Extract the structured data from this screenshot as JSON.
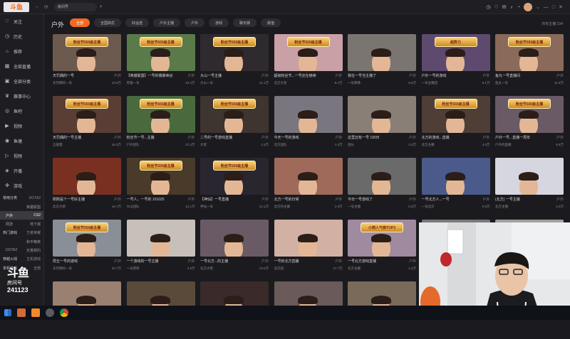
{
  "top": {
    "logo": "斗鱼",
    "search_text": "房间号",
    "nav_back": "←",
    "nav_refresh": "⟳"
  },
  "sidebar": {
    "items": [
      {
        "label": "关注",
        "icon": "heart-icon"
      },
      {
        "label": "历史",
        "icon": "clock-icon"
      },
      {
        "label": "推荐",
        "icon": "home-icon"
      },
      {
        "label": "全部直播",
        "icon": "grid-icon"
      },
      {
        "label": "全部分类",
        "icon": "category-icon"
      },
      {
        "label": "赛事中心",
        "icon": "trophy-icon"
      },
      {
        "label": "鱼吧",
        "icon": "fish-icon"
      },
      {
        "label": "视频",
        "icon": "video-icon"
      },
      {
        "label": "鱼塘",
        "icon": "pond-icon"
      },
      {
        "label": "视频",
        "icon": "play-icon"
      },
      {
        "label": "开播",
        "icon": "broadcast-icon"
      },
      {
        "label": "游戏",
        "icon": "game-icon"
      }
    ],
    "groups": [
      {
        "label": "常用分类",
        "count": "DOTA2"
      },
      {
        "label": "",
        "count": "英雄联盟"
      },
      {
        "label": "户外",
        "count": "CS2"
      },
      {
        "label": "网游",
        "count": "地下城"
      },
      {
        "label": "热门游戏",
        "count": "王者荣耀"
      },
      {
        "label": "",
        "count": "和平精英"
      },
      {
        "label": "DOTA2",
        "count": "无畏契约"
      },
      {
        "label": "穿越火线",
        "count": "主机游戏"
      },
      {
        "label": "单机游戏",
        "count": "全部"
      }
    ],
    "brand_logo": "斗鱼",
    "brand_room_label": "房间号",
    "brand_room_number": "241123"
  },
  "main": {
    "category_title": "户外",
    "tabs": [
      "全部",
      "全国高优",
      "好运连",
      "户外主播",
      "户外",
      "游戏",
      "聊天娱",
      "颜值"
    ],
    "sort_note": "共有主播 234"
  },
  "cards": [
    {
      "title": "天罚偶的一号",
      "cat": "户外",
      "streamer": "天罚偶的一号",
      "views": "10.6万",
      "thumb": "#6d5a4e",
      "banner": "粉丝节555级主播"
    },
    {
      "title": "【英雄联盟】一号的偶像峡谷",
      "cat": "户外",
      "streamer": "英雄一号",
      "views": "23.4万",
      "thumb": "#5a7a4a",
      "banner": "粉丝节555级主播"
    },
    {
      "title": "大山一号主播",
      "cat": "户外",
      "streamer": "大山一号",
      "views": "12.1万",
      "thumb": "#2f2a2e",
      "banner": "粉丝节555级主播"
    },
    {
      "title": "超级粉丝节...一号还在继续",
      "cat": "户外",
      "streamer": "北方大星",
      "views": "8.2万",
      "thumb": "#c8a0a6",
      "banner": "粉丝节555级主播"
    },
    {
      "title": "我在一号当主播了",
      "cat": "户外",
      "streamer": "一号偶像",
      "views": "5.6万",
      "thumb": "#7a7570",
      "banner": ""
    },
    {
      "title": "户外一号的游戏",
      "cat": "户外",
      "streamer": "一号主播团",
      "views": "9.1万",
      "thumb": "#5e4a6e",
      "banner": "超势力"
    },
    {
      "title": "鱼丸一号直播间",
      "cat": "户外",
      "streamer": "鱼丸一号",
      "views": "11.9万",
      "thumb": "#8a6a5a",
      "banner": "粉丝节555级主播"
    },
    {
      "title": "天罚偶的一号主播",
      "cat": "户外",
      "streamer": "正能量",
      "views": "16.3万",
      "thumb": "#5a3e36",
      "banner": "粉丝节555级主播"
    },
    {
      "title": "粉丝节一号...主播",
      "cat": "户外",
      "streamer": "户外团队",
      "views": "27.4万",
      "thumb": "#4a6a3e",
      "banner": "粉丝节555级主播"
    },
    {
      "title": "二号的一号游戏直播",
      "cat": "户外",
      "streamer": "大佬",
      "views": "1.5万",
      "thumb": "#3e3430",
      "banner": "粉丝节555级主播"
    },
    {
      "title": "今天一号的游戏",
      "cat": "户外",
      "streamer": "北方团队",
      "views": "1.4万",
      "thumb": "#7a7680",
      "banner": ""
    },
    {
      "title": "这里还有一号 190日",
      "cat": "户外",
      "streamer": "团长",
      "views": "2.0万",
      "thumb": "#8a7f76",
      "banner": ""
    },
    {
      "title": "北方的游戏...直播",
      "cat": "户外",
      "streamer": "北方主播",
      "views": "4.5万",
      "thumb": "#4e3e36",
      "banner": "粉丝节555级主播"
    },
    {
      "title": "户外一号...直播一周年",
      "cat": "户外",
      "streamer": "户外的直播",
      "views": "5.5万",
      "thumb": "#6a5a66",
      "banner": "粉丝节555级主播"
    },
    {
      "title": "刚刚是个一号好主播",
      "cat": "户外",
      "streamer": "北方大佬",
      "views": "16.7万",
      "thumb": "#7a3020",
      "banner": ""
    },
    {
      "title": "一号人，一号的 101025",
      "cat": "户外",
      "streamer": "大山团队",
      "views": "12.1万",
      "thumb": "#4a3a2a",
      "banner": "粉丝节555级主播"
    },
    {
      "title": "【神仙】一号直播",
      "cat": "户外",
      "streamer": "神仙一号",
      "views": "13.1万",
      "thumb": "#2a2630",
      "banner": "粉丝节555级主播"
    },
    {
      "title": "北方一号的日常",
      "cat": "户外",
      "streamer": "北方的主播",
      "views": "2.9万",
      "thumb": "#a06a5a",
      "banner": ""
    },
    {
      "title": "今日一号游戏了",
      "cat": "户外",
      "streamer": "一号主播",
      "views": "0.6万",
      "thumb": "#6a6a6a",
      "banner": ""
    },
    {
      "title": "一号北方人...一号",
      "cat": "户外",
      "streamer": "一号北方",
      "views": "0.6万",
      "thumb": "#4a5a8a",
      "banner": ""
    },
    {
      "title": "(北方) 一号主播",
      "cat": "户外",
      "streamer": "北方主播",
      "views": "3.3万",
      "thumb": "#d6d6e0",
      "banner": ""
    },
    {
      "title": "周五一号的游戏",
      "cat": "户外",
      "streamer": "天罚偶的一号",
      "views": "20.7万",
      "thumb": "#8a8e96",
      "banner": "粉丝节555级主播"
    },
    {
      "title": "一个游戏的一号主播",
      "cat": "户外",
      "streamer": "一号游戏",
      "views": "3.9万",
      "thumb": "#c6c0b8",
      "banner": ""
    },
    {
      "title": "一号北方...的主播",
      "cat": "户外",
      "streamer": "北方大佬",
      "views": "13.0万",
      "thumb": "#6a5a66",
      "banner": ""
    },
    {
      "title": "一号的北方直播",
      "cat": "户外",
      "streamer": "北方团",
      "views": "17.7万",
      "thumb": "#d2b0a4",
      "banner": ""
    },
    {
      "title": "一号北方游戏直播",
      "cat": "户外",
      "streamer": "北方主播",
      "views": "1.3万",
      "thumb": "#a08aa0",
      "banner": "小岗人气榜TOP3"
    },
    {
      "title": "【户外】一号北方游戏",
      "cat": "户外",
      "streamer": "北方大佬",
      "views": "9.3万",
      "thumb": "#7a7a7a",
      "banner": ""
    },
    {
      "title": "",
      "cat": "",
      "streamer": "",
      "views": "",
      "thumb": "#a0a0a0",
      "banner": ""
    },
    {
      "title": "",
      "cat": "",
      "streamer": "",
      "views": "",
      "thumb": "#9a8070",
      "banner": ""
    },
    {
      "title": "",
      "cat": "",
      "streamer": "",
      "views": "",
      "thumb": "#5a4a3a",
      "banner": ""
    },
    {
      "title": "",
      "cat": "",
      "streamer": "",
      "views": "",
      "thumb": "#3a2a2a",
      "banner": ""
    },
    {
      "title": "",
      "cat": "",
      "streamer": "",
      "views": "",
      "thumb": "#6a5a5a",
      "banner": ""
    },
    {
      "title": "",
      "cat": "",
      "streamer": "",
      "views": "",
      "thumb": "#7a6a5a",
      "banner": ""
    }
  ],
  "taskbar": {
    "icons": [
      "windows-icon",
      "search-icon",
      "douyu-icon",
      "app-icon",
      "chrome-icon"
    ]
  },
  "colors": {
    "accent": "#f36b21",
    "background": "#1b1b1f"
  }
}
